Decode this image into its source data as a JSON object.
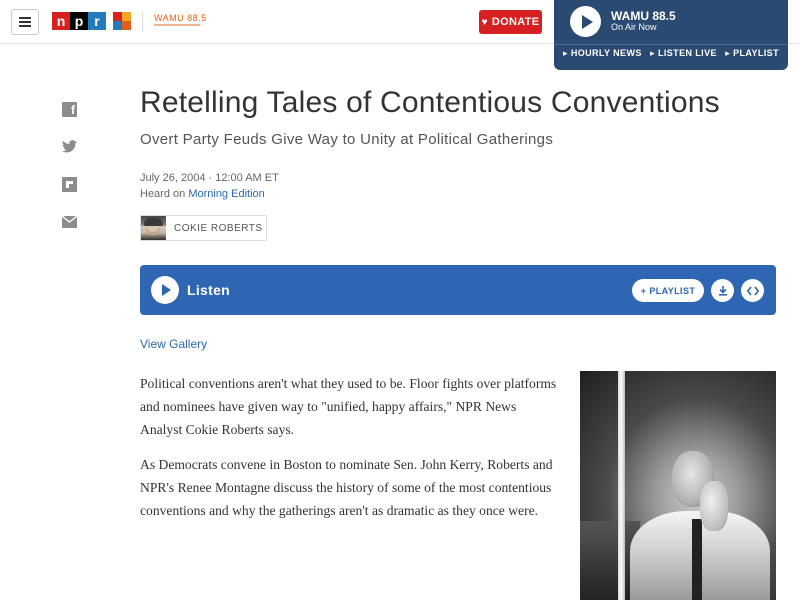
{
  "header": {
    "logo_letters": [
      "n",
      "p",
      "r"
    ],
    "station_logo": "WAMU 88.5",
    "donate_label": "DONATE"
  },
  "player": {
    "station": "WAMU 88.5",
    "status": "On Air Now",
    "links": [
      "HOURLY NEWS",
      "LISTEN LIVE",
      "PLAYLIST"
    ]
  },
  "social": [
    "facebook-icon",
    "twitter-icon",
    "flipboard-icon",
    "email-icon"
  ],
  "article": {
    "title": "Retelling Tales of Contentious Conventions",
    "subtitle": "Overt Party Feuds Give Way to Unity at Political Gatherings",
    "date": "July 26, 2004 · 12:00 AM ET",
    "heard_prefix": "Heard on ",
    "heard_program": "Morning Edition",
    "author": "COKIE ROBERTS",
    "listen_label": "Listen",
    "playlist_label": "PLAYLIST",
    "view_gallery": "View Gallery",
    "paragraphs": [
      "Political conventions aren't what they used to be. Floor fights over platforms and nominees have given way to \"unified, happy affairs,\" NPR News Analyst Cokie Roberts says.",
      "As Democrats convene in Boston to nominate Sen. John Kerry, Roberts and NPR's Renee Montagne discuss the history of some of the most contentious conventions and why the gatherings aren't as dramatic as they once were."
    ]
  },
  "colors": {
    "npr_red": "#d62021",
    "npr_blue": "#237bbd",
    "player_bg": "#2b4a72",
    "listen_bg": "#2e66b3",
    "link": "#2b6aad"
  }
}
